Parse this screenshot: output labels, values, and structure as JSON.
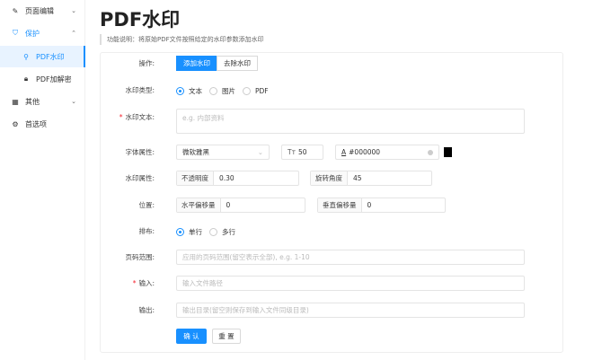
{
  "sidebar": {
    "items": [
      {
        "label": "页面编辑",
        "icon": "edit-icon"
      },
      {
        "label": "保护",
        "icon": "shield-icon"
      },
      {
        "label": "PDF水印",
        "icon": "stamp-icon"
      },
      {
        "label": "PDF加解密",
        "icon": "lock-icon"
      },
      {
        "label": "其他",
        "icon": "grid-icon"
      },
      {
        "label": "首选项",
        "icon": "gear-icon"
      }
    ]
  },
  "page": {
    "title": "PDF水印",
    "description": "功能说明：将原始PDF文件按照给定的水印参数添加水印"
  },
  "form": {
    "operation": {
      "label": "操作:",
      "options": [
        "添加水印",
        "去除水印"
      ],
      "selected": "添加水印"
    },
    "type": {
      "label": "水印类型:",
      "options": [
        "文本",
        "图片",
        "PDF"
      ],
      "selected": "文本"
    },
    "text": {
      "label": "水印文本:",
      "placeholder": "e.g. 内部资料"
    },
    "font": {
      "label": "字体属性:",
      "family": "微软雅黑",
      "size": "50",
      "size_icon": "Tт",
      "color": "#000000",
      "color_icon": "A"
    },
    "props": {
      "label": "水印属性:",
      "opacity_label": "不透明度",
      "opacity": "0.30",
      "rotation_label": "旋转角度",
      "rotation": "45"
    },
    "position": {
      "label": "位置:",
      "h_label": "水平偏移量",
      "h": "0",
      "v_label": "垂直偏移量",
      "v": "0"
    },
    "layout": {
      "label": "排布:",
      "options": [
        "单行",
        "多行"
      ],
      "selected": "单行"
    },
    "range": {
      "label": "页码范围:",
      "placeholder": "应用的页码范围(留空表示全部), e.g. 1-10"
    },
    "input": {
      "label": "输入:",
      "placeholder": "输入文件路径"
    },
    "output": {
      "label": "输出:",
      "placeholder": "输出目录(留空则保存到输入文件同级目录)"
    },
    "confirm": "确 认",
    "reset": "重 置"
  },
  "colors": {
    "accent": "#1890ff",
    "swatch": "#000000"
  }
}
